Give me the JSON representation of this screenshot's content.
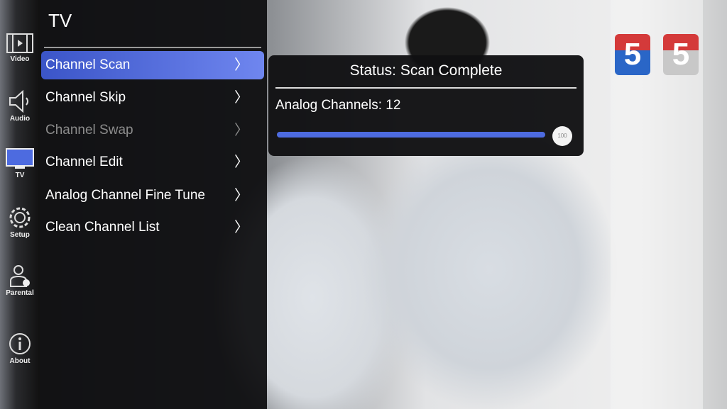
{
  "sidebar": {
    "items": [
      {
        "label": "Video",
        "icon": "film-icon"
      },
      {
        "label": "Audio",
        "icon": "speaker-icon"
      },
      {
        "label": "TV",
        "icon": "tv-icon",
        "active": true
      },
      {
        "label": "Setup",
        "icon": "gear-icon"
      },
      {
        "label": "Parental",
        "icon": "person-lock-icon"
      },
      {
        "label": "About",
        "icon": "info-icon"
      }
    ]
  },
  "menu": {
    "title": "TV",
    "chevron": "〉",
    "items": [
      {
        "label": "Channel Scan",
        "state": "selected"
      },
      {
        "label": "Channel Skip",
        "state": "normal"
      },
      {
        "label": "Channel Swap",
        "state": "disabled"
      },
      {
        "label": "Channel Edit",
        "state": "normal"
      },
      {
        "label": "Analog Channel Fine Tune",
        "state": "normal"
      },
      {
        "label": "Clean Channel List",
        "state": "normal"
      }
    ]
  },
  "popup": {
    "status": "Status: Scan Complete",
    "count": "Analog Channels: 12",
    "progress_percent": 100,
    "progress_label": "100"
  },
  "broadcast": {
    "logo_text": "5",
    "colors": {
      "accent": "#4d6be0",
      "logo": "#d43a3a"
    }
  }
}
